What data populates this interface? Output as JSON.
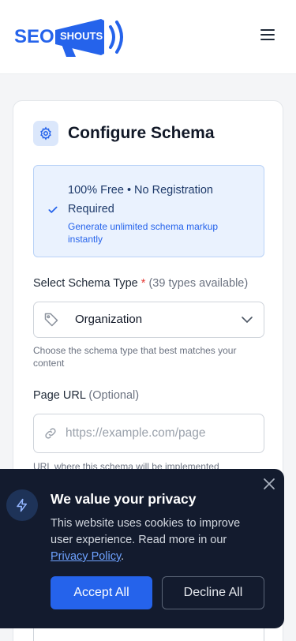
{
  "header": {
    "logo": {
      "text_left": "SEO",
      "text_right": "SHOUTS",
      "icon": "megaphone-icon",
      "color": "#2563eb"
    },
    "menu_icon": "hamburger-menu-icon"
  },
  "card": {
    "icon": "gear-icon",
    "title": "Configure Schema",
    "promo": {
      "icon": "check-icon",
      "title": "100% Free • No Registration Required",
      "subtitle": "Generate unlimited schema markup instantly"
    },
    "schema_type": {
      "label": "Select Schema Type",
      "required_mark": "*",
      "count_text": "(39 types available)",
      "icon": "tag-icon",
      "selected": "Organization",
      "hint": "Choose the schema type that best matches your content"
    },
    "page_url": {
      "label": "Page URL",
      "optional_text": "(Optional)",
      "icon": "link-icon",
      "placeholder": "https://example.com/page",
      "value": "",
      "hint": "URL where this schema will be implemented"
    }
  },
  "cookie_banner": {
    "icon": "lightning-icon",
    "title": "We value your privacy",
    "text": "This website uses cookies to improve user experience. Read more in our",
    "link_text": "Privacy Policy",
    "text_end": ".",
    "accept_label": "Accept All",
    "decline_label": "Decline All",
    "close_icon": "close-icon"
  },
  "colors": {
    "accent": "#2563eb",
    "banner_bg": "#131b2e",
    "required": "#e53935"
  }
}
